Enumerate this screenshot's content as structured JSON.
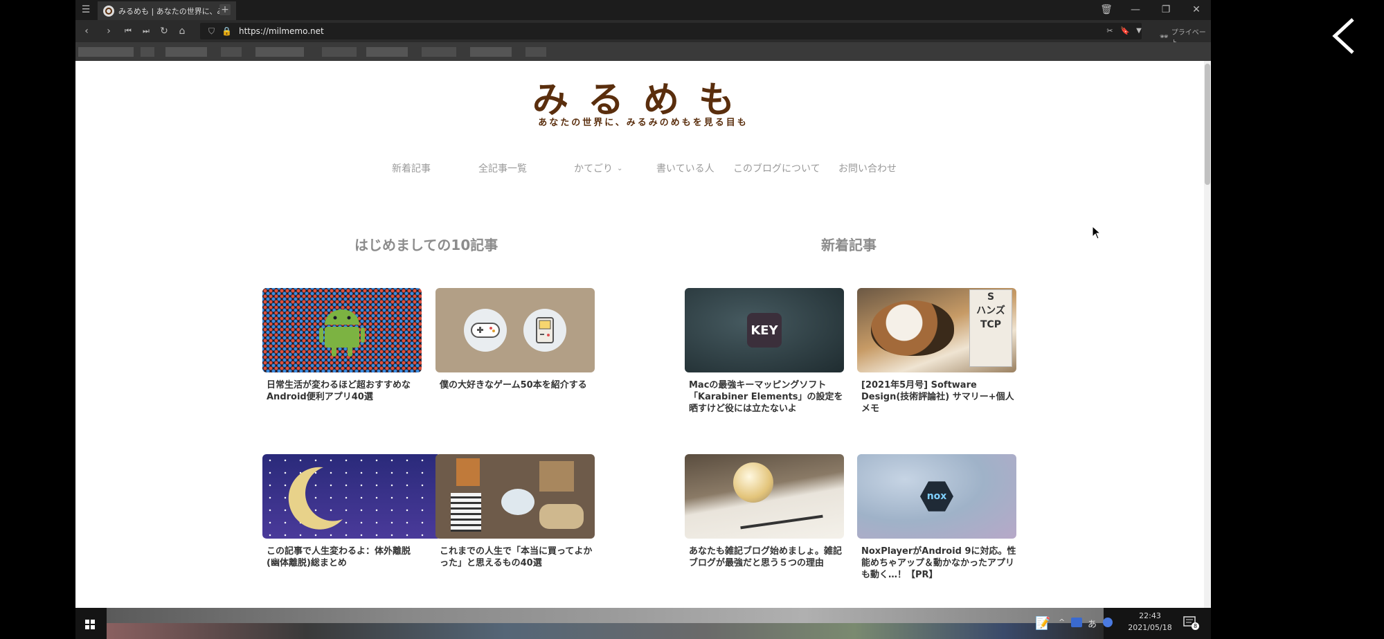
{
  "browser": {
    "tab_title": "みるめも | あなたの世界に、み",
    "url": "https://milmemo.net",
    "private_label": "プライベート"
  },
  "site": {
    "logo_text": "みるめも",
    "tagline": "あなたの世界に、みるみのめもを見る目も",
    "nav": [
      "新着記事",
      "全記事一覧",
      "かてごり",
      "書いている人",
      "このブログについて",
      "お問い合わせ"
    ]
  },
  "sections": {
    "left_title": "はじめましての10記事",
    "right_title": "新着記事"
  },
  "cards": [
    {
      "title": "日常生活が変わるほど超おすすめなAndroid便利アプリ40選",
      "icon": "android-icon"
    },
    {
      "title": "僕の大好きなゲーム50本を紹介する",
      "icon": "gamepad-icon"
    },
    {
      "title": "Macの最強キーマッピングソフト「Karabiner Elements」の設定を晒すけど役には立たないよ",
      "badge": "KEY"
    },
    {
      "title": "[2021年5月号] Software Design(技術評論社) サマリー+個人メモ",
      "icon": "cat-photo"
    },
    {
      "title": "この記事で人生変わるよ：体外離脱(幽体離脱)総まとめ",
      "icon": "moon-icon"
    },
    {
      "title": "これまでの人生で「本当に買ってよかった」と思えるもの40選",
      "icon": "items-photo"
    },
    {
      "title": "あなたも雑記ブログ始めましょ。雑記ブログが最強だと思う５つの理由",
      "icon": "lightbulb-photo"
    },
    {
      "title": "NoxPlayerがAndroid 9に対応。性能めちゃアップ＆動かなかったアプリも動く…！【PR】",
      "badge": "nox"
    }
  ],
  "taskbar": {
    "ime": "あ",
    "time": "22:43",
    "date": "2021/05/18",
    "notif_count": "8"
  },
  "colors": {
    "logo_brown": "#5a2e0d",
    "chrome_dark": "#1c1c1c"
  }
}
